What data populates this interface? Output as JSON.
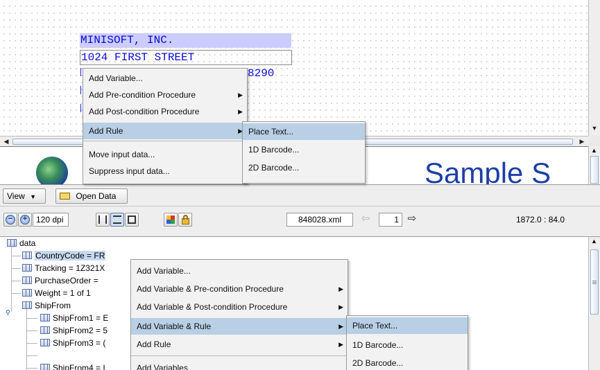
{
  "canvas": {
    "line1": "MINISOFT, INC.",
    "line2": "1024 FIRST STREET",
    "line3": "8290"
  },
  "preview": {
    "title": "Sample S"
  },
  "toolbar1": {
    "view_label": "View",
    "open_data_label": "Open Data"
  },
  "toolbar2": {
    "dpi": "120 dpi",
    "file_name": "848028.xml",
    "page": "1",
    "coords": "1872.0 : 84.0"
  },
  "tree": {
    "root": "data",
    "items": [
      {
        "label": "CountryCode = FR",
        "selected": true
      },
      {
        "label": "Tracking = 1Z321X"
      },
      {
        "label": "PurchaseOrder = "
      },
      {
        "label": "Weight = 1 of 1"
      },
      {
        "label": "ShipFrom"
      },
      {
        "label": "ShipFrom1 = E"
      },
      {
        "label": "ShipFrom2 = 5"
      },
      {
        "label": "ShipFrom3 = ("
      },
      {
        "label": "ShipFrom4 = I"
      }
    ]
  },
  "menu_top": {
    "items": [
      {
        "label": "Add Variable..."
      },
      {
        "label": "Add Pre-condition Procedure"
      },
      {
        "label": "Add Post-condition Procedure"
      },
      {
        "label": "Add Rule"
      },
      {
        "label": "Move input data..."
      },
      {
        "label": "Suppress input data..."
      }
    ]
  },
  "submenu_top": {
    "items": [
      {
        "label": "Place Text..."
      },
      {
        "label": "1D Barcode..."
      },
      {
        "label": "2D Barcode..."
      }
    ]
  },
  "menu_bottom": {
    "items": [
      {
        "label": "Add Variable..."
      },
      {
        "label": "Add Variable & Pre-condition Procedure"
      },
      {
        "label": "Add Variable & Post-condition Procedure"
      },
      {
        "label": "Add Variable & Rule"
      },
      {
        "label": "Add Rule"
      },
      {
        "label": "Add Variables"
      }
    ]
  },
  "submenu_bottom": {
    "items": [
      {
        "label": "Place Text..."
      },
      {
        "label": "1D Barcode..."
      },
      {
        "label": "2D Barcode..."
      }
    ]
  },
  "colors": {
    "label_text": "#0b0bd8",
    "highlight": "#b8cfe5",
    "selection": "#ccccff"
  }
}
